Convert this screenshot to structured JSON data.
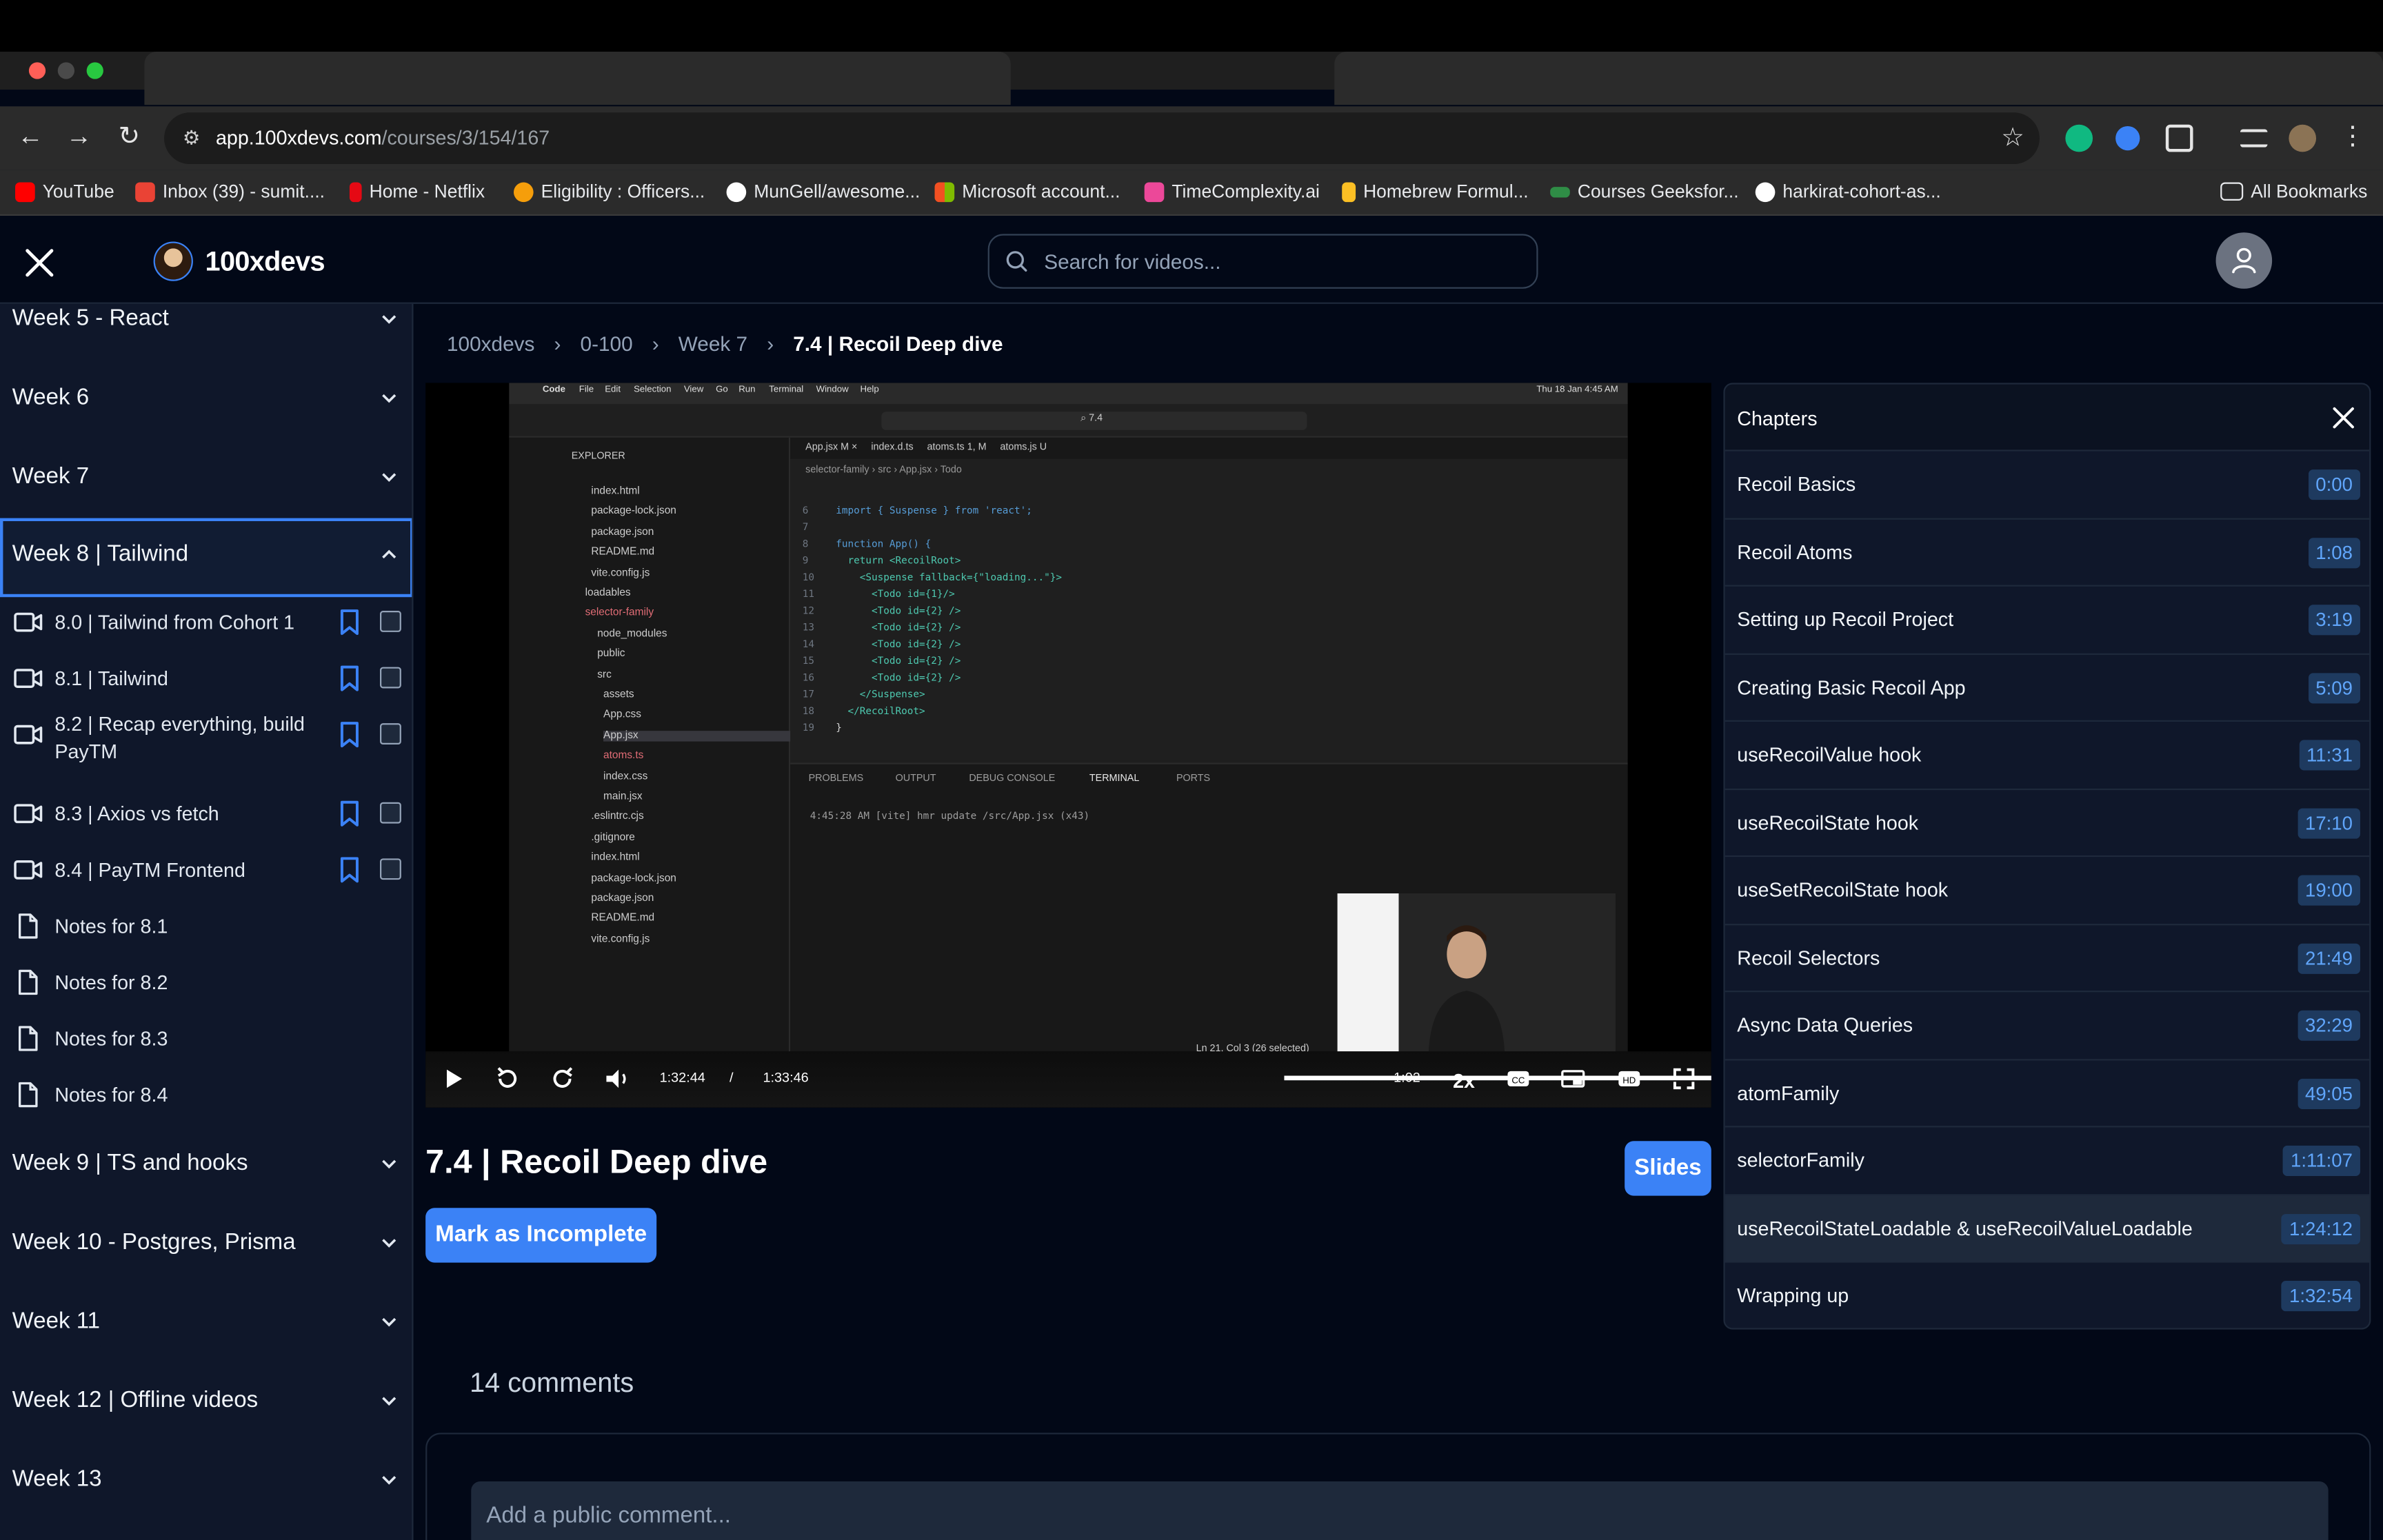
{
  "browser": {
    "url_host": "app.100xdevs.com",
    "url_path": "/courses/3/154/167",
    "bookmarks": [
      {
        "label": "YouTube",
        "color": "#ff0000"
      },
      {
        "label": "Inbox (39) - sumit....",
        "color": "#ea4335"
      },
      {
        "label": "Home - Netflix",
        "color": "#e50914"
      },
      {
        "label": "Eligibility : Officers...",
        "color": "#f59e0b"
      },
      {
        "label": "MunGell/awesome...",
        "color": "#ffffff"
      },
      {
        "label": "Microsoft account...",
        "color": "#00a4ef"
      },
      {
        "label": "TimeComplexity.ai",
        "color": "#ec4899"
      },
      {
        "label": "Homebrew Formul...",
        "color": "#fbbf24"
      },
      {
        "label": "Courses Geeksfor...",
        "color": "#2f8d46"
      },
      {
        "label": "harkirat-cohort-as...",
        "color": "#ffffff"
      }
    ],
    "all_bookmarks": "All Bookmarks"
  },
  "app": {
    "logo": "100xdevs",
    "search_placeholder": "Search for videos..."
  },
  "sidebar": {
    "weeks_top": [
      {
        "label": "Week 5 - React"
      },
      {
        "label": "Week 6"
      },
      {
        "label": "Week 7"
      }
    ],
    "active_week": "Week 8 | Tailwind",
    "items": [
      {
        "label": "8.0 | Tailwind from Cohort 1",
        "type": "video"
      },
      {
        "label": "8.1 | Tailwind",
        "type": "video"
      },
      {
        "label": "8.2 | Recap everything, build PayTM",
        "type": "video"
      },
      {
        "label": "8.3 | Axios vs fetch",
        "type": "video"
      },
      {
        "label": "8.4 | PayTM Frontend",
        "type": "video"
      },
      {
        "label": "Notes for 8.1",
        "type": "notes"
      },
      {
        "label": "Notes for 8.2",
        "type": "notes"
      },
      {
        "label": "Notes for 8.3",
        "type": "notes"
      },
      {
        "label": "Notes for 8.4",
        "type": "notes"
      }
    ],
    "weeks_bottom": [
      {
        "label": "Week 9 | TS and hooks"
      },
      {
        "label": "Week 10 - Postgres, Prisma"
      },
      {
        "label": "Week 11"
      },
      {
        "label": "Week 12 | Offline videos"
      },
      {
        "label": "Week 13"
      }
    ]
  },
  "breadcrumb": [
    "100xdevs",
    "0-100",
    "Week 7",
    "7.4 | Recoil Deep dive"
  ],
  "player": {
    "time_current": "1:32:44",
    "time_total": "1:33:46",
    "time_remaining": "-1:02",
    "speed": "2x",
    "progress": 0.989,
    "vscode": {
      "explorer_title": "EXPLORER",
      "files": [
        "index.html",
        "package-lock.json",
        "package.json",
        "README.md",
        "vite.config.js",
        "loadables",
        "selector-family",
        "node_modules",
        "public",
        "src",
        "assets",
        "App.css",
        "App.jsx",
        "atoms.ts",
        "index.css",
        "main.jsx",
        ".eslintrc.cjs",
        ".gitignore",
        "index.html",
        "package-lock.json",
        "package.json",
        "README.md",
        "vite.config.js"
      ],
      "code": [
        "import { Suspense } from 'react';",
        "",
        "function App() {",
        "  return <RecoilRoot>",
        "    <Suspense fallback={\"loading...\"}>",
        "      <Todo id={1}/>",
        "      <Todo id={2} />",
        "      <Todo id={2} />",
        "      <Todo id={2} />",
        "      <Todo id={2} />",
        "      <Todo id={2} />",
        "    </Suspense>",
        "  </RecoilRoot>",
        "}"
      ],
      "terminal_line": "4:45:28 AM [vite] hmr update /src/App.jsx (x43)",
      "panel_tabs": [
        "PROBLEMS",
        "OUTPUT",
        "DEBUG CONSOLE",
        "TERMINAL",
        "PORTS"
      ],
      "status": "Ln 21, Col 3 (26 selected)"
    }
  },
  "video": {
    "title": "7.4 | Recoil Deep dive",
    "slides_label": "Slides",
    "mark_label": "Mark as Incomplete"
  },
  "comments": {
    "count_label": "14 comments",
    "placeholder": "Add a public comment..."
  },
  "chapters": {
    "title": "Chapters",
    "items": [
      {
        "name": "Recoil Basics",
        "time": "0:00"
      },
      {
        "name": "Recoil Atoms",
        "time": "1:08"
      },
      {
        "name": "Setting up Recoil Project",
        "time": "3:19"
      },
      {
        "name": "Creating Basic Recoil App",
        "time": "5:09"
      },
      {
        "name": "useRecoilValue hook",
        "time": "11:31"
      },
      {
        "name": "useRecoilState hook",
        "time": "17:10"
      },
      {
        "name": "useSetRecoilState hook",
        "time": "19:00"
      },
      {
        "name": "Recoil Selectors",
        "time": "21:49"
      },
      {
        "name": "Async Data Queries",
        "time": "32:29"
      },
      {
        "name": "atomFamily",
        "time": "49:05"
      },
      {
        "name": "selectorFamily",
        "time": "1:11:07"
      },
      {
        "name": "useRecoilStateLoadable & useRecoilValueLoadable",
        "time": "1:24:12",
        "active": true
      },
      {
        "name": "Wrapping up",
        "time": "1:32:54"
      }
    ]
  }
}
